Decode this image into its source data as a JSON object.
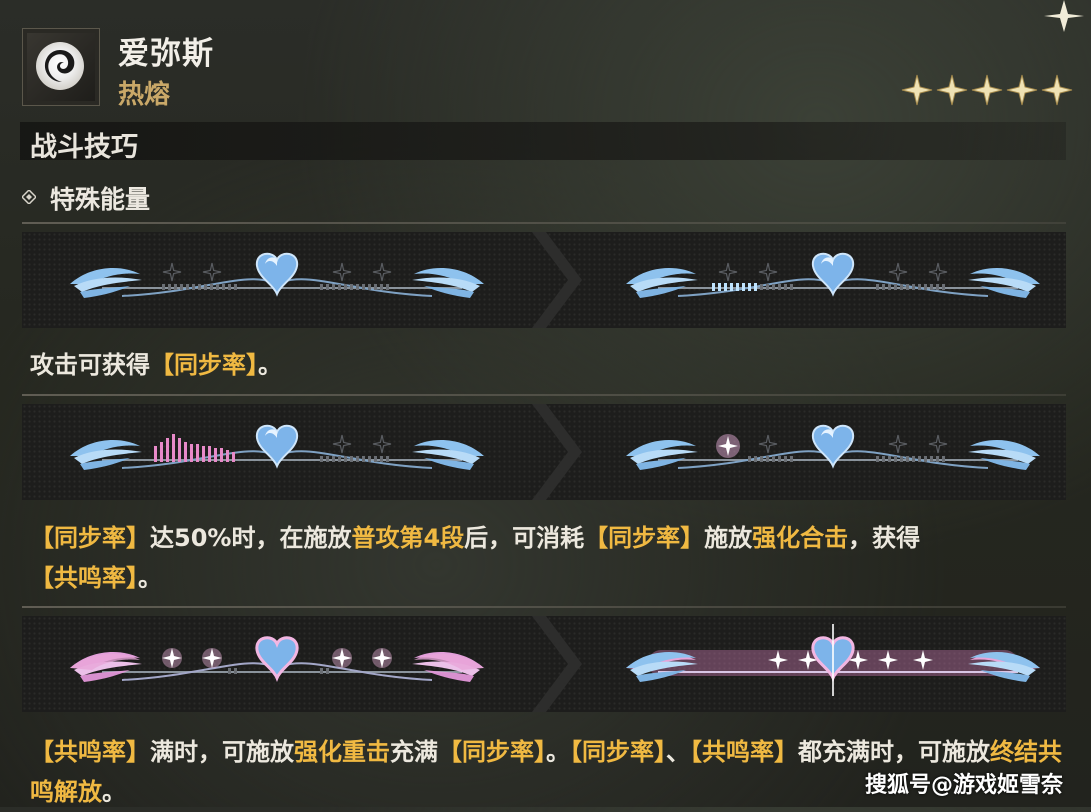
{
  "character": {
    "name": "爱弥斯",
    "element": "热熔",
    "rarity": 5,
    "emblem_icon": "fusion-swirl-icon"
  },
  "section": {
    "title": "战斗技巧"
  },
  "subsection": {
    "title": "特殊能量",
    "bullet_icon": "diamond-icon"
  },
  "gauges": [
    {
      "left_state": "sync-rate-empty",
      "right_state": "sync-rate-charging"
    },
    {
      "left_state": "sync-rate-half",
      "right_state": "sync-rate-consumed"
    },
    {
      "left_state": "resonance-full",
      "right_state": "both-full"
    }
  ],
  "descriptions": {
    "d1": {
      "p1": "攻击可获得",
      "h1": "【同步率】",
      "p2": "。"
    },
    "d2": {
      "h1": "【同步率】",
      "p1": "达50%时，在施放",
      "h2": "普攻第4段",
      "p2": "后，可消耗",
      "h3": "【同步率】",
      "p3": "施放",
      "h4": "强化合击",
      "p4": "，获得",
      "h5": "【共鸣率】",
      "p5": "。"
    },
    "d3": {
      "h1": "【共鸣率】",
      "p1": "满时，可施放",
      "h2": "强化重击",
      "p2": "充满",
      "h3": "【同步率】",
      "p3": "。",
      "h4": "【同步率】",
      "p4": "、",
      "h5": "【共鸣率】",
      "p5": "都充满时，可施放",
      "h6": "终结共鸣解放",
      "p6": "。"
    }
  },
  "watermark": "搜狐号@游戏姬雪奈",
  "colors": {
    "highlight": "#f0b942",
    "element": "#c9a868",
    "gauge_blue": "#9ecbf2",
    "gauge_pink": "#e88ac9"
  }
}
